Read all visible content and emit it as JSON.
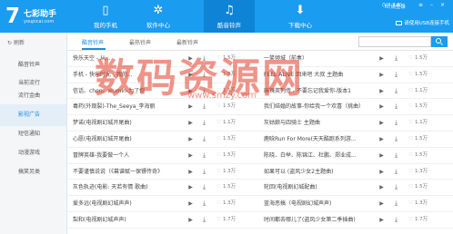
{
  "header": {
    "logo": {
      "mark": "7",
      "name": "七彩助手",
      "site": "youpicai.com"
    },
    "nav": [
      {
        "label": "我的手机",
        "icon": "phone-icon",
        "glyph": "▯"
      },
      {
        "label": "软件中心",
        "icon": "apps-icon",
        "glyph": "✲"
      },
      {
        "label": "酷音铃声",
        "icon": "music-icon",
        "glyph": "♫"
      },
      {
        "label": "下载中心",
        "icon": "download-icon",
        "glyph": "⬇"
      }
    ],
    "user_status": "hi,请登录",
    "version": "(V4.2.6)",
    "usb_hint": "请使用USB连接手机",
    "accent": "#1a9cf0"
  },
  "sidebar": {
    "refresh_label": "刷新",
    "items": [
      {
        "label": "酷音铃声"
      },
      {
        "label": "当前流行"
      },
      {
        "label": ""
      },
      {
        "label": "流行金曲"
      },
      {
        "label": "影视广告"
      },
      {
        "label": "短信通知"
      },
      {
        "label": "动漫游戏"
      },
      {
        "label": "搞笑另类"
      }
    ]
  },
  "tabs": [
    {
      "label": "酷音铃声"
    },
    {
      "label": "最热铃声"
    },
    {
      "label": "最新铃声"
    }
  ],
  "search": {
    "placeholder": ""
  },
  "watermark": {
    "main": "数码资源网",
    "sub": "www.smzy.com"
  },
  "rows": [
    {
      "left": {
        "name": "快乐天空 - 从...",
        "count": "1.5万"
      },
      "right": {
        "name": "一笑倾城（前奏）",
        "count": "1.5万"
      }
    },
    {
      "left": {
        "name": "手机 - 快乐时光 - 我的...",
        "count": "1.5万"
      },
      "right": {
        "name": "FEEL ALIVE 回来吧 大叔 主题曲",
        "count": "1.5万"
      }
    },
    {
      "left": {
        "name": "信话、chen、xiumin-为了你",
        "count": "1.1万"
      },
      "right": {
        "name": "麻辣英列传 - 不要忘记我爱你-版本1",
        "count": "1.1万"
      }
    },
    {
      "left": {
        "name": "毒药(外观裂)-The_Seeya_李海丽",
        "count": "1.5万"
      },
      "right": {
        "name": "我们结婚的故事-你给我一个欢喜（挑曲）",
        "count": "1.5万"
      }
    },
    {
      "left": {
        "name": "梦诺(电视剧幻城开尾曲)",
        "count": "1.1万"
      },
      "right": {
        "name": "灰姑娘与四骑士 主题曲",
        "count": "1.1万"
      }
    },
    {
      "left": {
        "name": "心愿(电视剧幻城开尾曲)",
        "count": "1.5万"
      },
      "right": {
        "name": "鹿晗Run For More(天天酷跑系列游...",
        "count": "1.5万"
      }
    },
    {
      "left": {
        "name": "冒牌英雄-我要做一个人",
        "count": "1.5万"
      },
      "right": {
        "name": "陈晓、白举、陈锦江、杜鹏、郑业成...",
        "count": "1.5万"
      }
    },
    {
      "left": {
        "name": "不要谨慎说说（《幕谱赋一保镖传奇》",
        "count": "1.3万"
      },
      "right": {
        "name": "如果可以 (盗风少女2主题曲)",
        "count": "1.3万"
      }
    },
    {
      "left": {
        "name": "灰色轨迹(电影: 天若有情 歌曲)",
        "count": "1.5万"
      },
      "right": {
        "name": "轮回(电视剧幻城配曲)",
        "count": "1.5万"
      }
    },
    {
      "left": {
        "name": "爱多远(电视剧幻城声声)",
        "count": "1.3万"
      },
      "right": {
        "name": "蓝海恶搞（电视剧幻城声声)",
        "count": "1.3万"
      }
    },
    {
      "left": {
        "name": "梨和(电视剧幻城声声)",
        "count": "1.7万"
      },
      "right": {
        "name": "时间都去哪儿了(盗风少女第二季插曲)",
        "count": "1.7万"
      }
    }
  ]
}
